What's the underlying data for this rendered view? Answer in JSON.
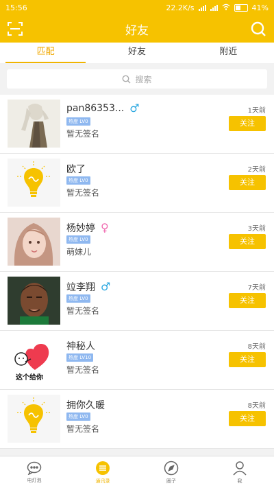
{
  "status_bar": {
    "time": "15:56",
    "network": "22.2K/s",
    "battery": "41%"
  },
  "header": {
    "title": "好友"
  },
  "tabs": [
    {
      "label": "匹配",
      "active": true
    },
    {
      "label": "好友",
      "active": false
    },
    {
      "label": "附近",
      "active": false
    }
  ],
  "search": {
    "placeholder": "搜索"
  },
  "users": [
    {
      "name": "pan86353...",
      "gender": "male",
      "level": "热度 LV0",
      "signature": "暂无签名",
      "time": "1天前",
      "follow_label": "关注"
    },
    {
      "name": "欧了",
      "gender": "",
      "level": "热度 LV0",
      "signature": "暂无签名",
      "time": "2天前",
      "follow_label": "关注"
    },
    {
      "name": "杨妙婷",
      "gender": "female",
      "level": "热度 LV0",
      "signature": "萌妹儿",
      "time": "3天前",
      "follow_label": "关注"
    },
    {
      "name": "竝李翔",
      "gender": "male",
      "level": "热度 LV0",
      "signature": "暂无签名",
      "time": "7天前",
      "follow_label": "关注"
    },
    {
      "name": "神秘人",
      "gender": "",
      "level": "热度 LV10",
      "signature": "暂无签名",
      "time": "8天前",
      "follow_label": "关注"
    },
    {
      "name": "拥你久暖",
      "gender": "",
      "level": "热度 LV0",
      "signature": "暂无签名",
      "time": "8天前",
      "follow_label": "关注"
    }
  ],
  "sticker_text": "这个给你",
  "bottom_nav": [
    {
      "label": "电灯泡",
      "icon": "chat-bubble-icon",
      "active": false
    },
    {
      "label": "通讯录",
      "icon": "contacts-icon",
      "active": true
    },
    {
      "label": "圈子",
      "icon": "compass-icon",
      "active": false
    },
    {
      "label": "我",
      "icon": "profile-icon",
      "active": false
    }
  ],
  "colors": {
    "accent": "#f6c200",
    "male": "#2aa7e0",
    "female": "#f06ab0",
    "badge": "#8fb8f0"
  }
}
